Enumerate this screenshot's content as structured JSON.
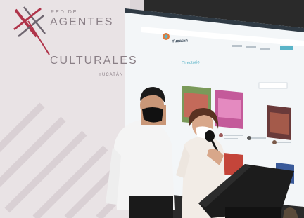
{
  "banner": {
    "line1": "RED DE",
    "line2": "AGENTES",
    "line3": "CULTURALES",
    "line4": "YUCATÁN"
  },
  "screen": {
    "brand": "Yucatán",
    "section_title": "Directorio"
  },
  "colors": {
    "banner_bg": "#e9e3e5",
    "banner_text": "#8a7f86",
    "logo_red": "#b0344a",
    "screen_bg": "#f3f6f8",
    "accent": "#5ab4c8",
    "podium": "#1c1c1c"
  }
}
